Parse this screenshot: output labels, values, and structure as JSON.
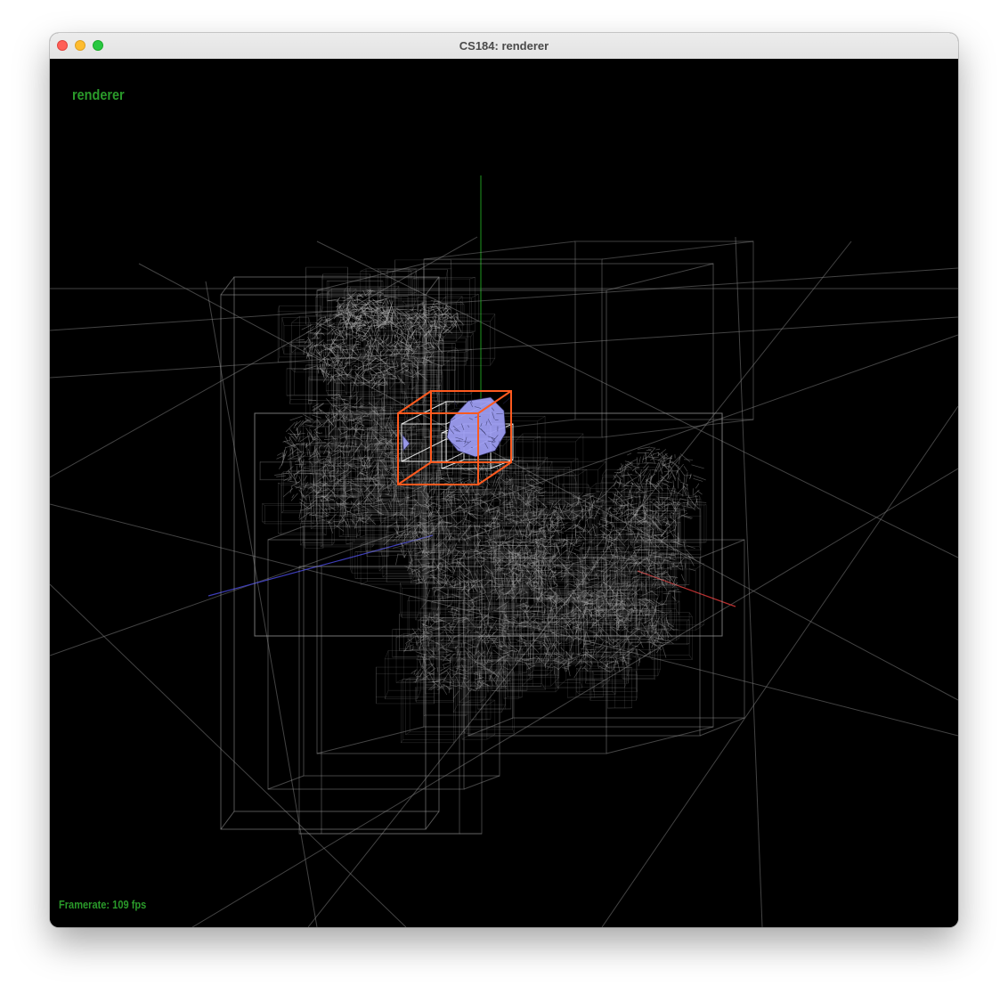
{
  "window": {
    "title": "CS184: renderer",
    "traffic_lights": [
      "close",
      "minimize",
      "maximize"
    ]
  },
  "viewport": {
    "hud_title": "renderer",
    "framerate": "Framerate: 109 fps",
    "background": "#000000",
    "hud_color": "#2a9a2a",
    "colors": {
      "grid": "#7a7a7a",
      "bvh_box": "#9a9a9a",
      "selected_box": "#ff5a1f",
      "selected_mesh": "#9c9cf0",
      "axis_x": "#cc3333",
      "axis_y": "#22aa22",
      "axis_z": "#4444cc"
    }
  }
}
